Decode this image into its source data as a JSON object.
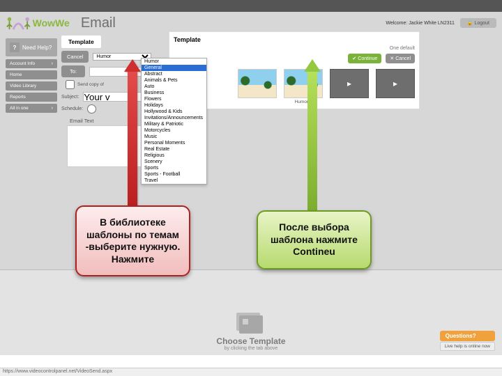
{
  "header": {
    "logo_text": "WowWe",
    "page_title": "Email",
    "welcome": "Welcome: Jackie White LN2311",
    "logout": "Logout"
  },
  "sidebar": {
    "need_help": "Need Help?",
    "items": [
      {
        "label": "Account Info"
      },
      {
        "label": "Home"
      },
      {
        "label": "Video Library"
      },
      {
        "label": "Reports"
      },
      {
        "label": "All in one"
      }
    ]
  },
  "email_form": {
    "step_tab": "Template",
    "cancel": "Cancel",
    "category_selected": "Humor",
    "to_button": "To:",
    "send_copy": "Send copy of",
    "subject_label": "Subject:",
    "subject_value": "Your v",
    "schedule_label": "Schedule:",
    "email_text_label": "Email Text"
  },
  "category_options": [
    "Humor",
    "General",
    "Abstract",
    "Animals & Pets",
    "Auto",
    "Business",
    "Flowers",
    "Holidays",
    "Hollywood & Kids",
    "Invitations/Announcements",
    "Military & Patriotic",
    "Motorcycles",
    "Music",
    "Personal Moments",
    "Real Estate",
    "Religious",
    "Scenery",
    "Sports",
    "Sports - Football",
    "Travel"
  ],
  "template_panel": {
    "title": "Template",
    "default_label": "One default",
    "continue": "Continue",
    "cancel": "Cancel",
    "thumbs": [
      {
        "caption": ""
      },
      {
        "caption": "Humor 1"
      },
      {
        "caption": ""
      },
      {
        "caption": ""
      }
    ]
  },
  "choose": {
    "title": "Choose Template",
    "subtitle": "by clicking the tab above"
  },
  "help_widget": {
    "questions": "Questions?",
    "live": "Live help is online now"
  },
  "callouts": {
    "red_text": "В библиотеке шаблоны по темам -выберите нужную. Нажмите",
    "green_text": "После выбора шаблона нажмите Contineu"
  },
  "status_url": "https://www.videocontrolpanel.net/VideoSend.aspx"
}
